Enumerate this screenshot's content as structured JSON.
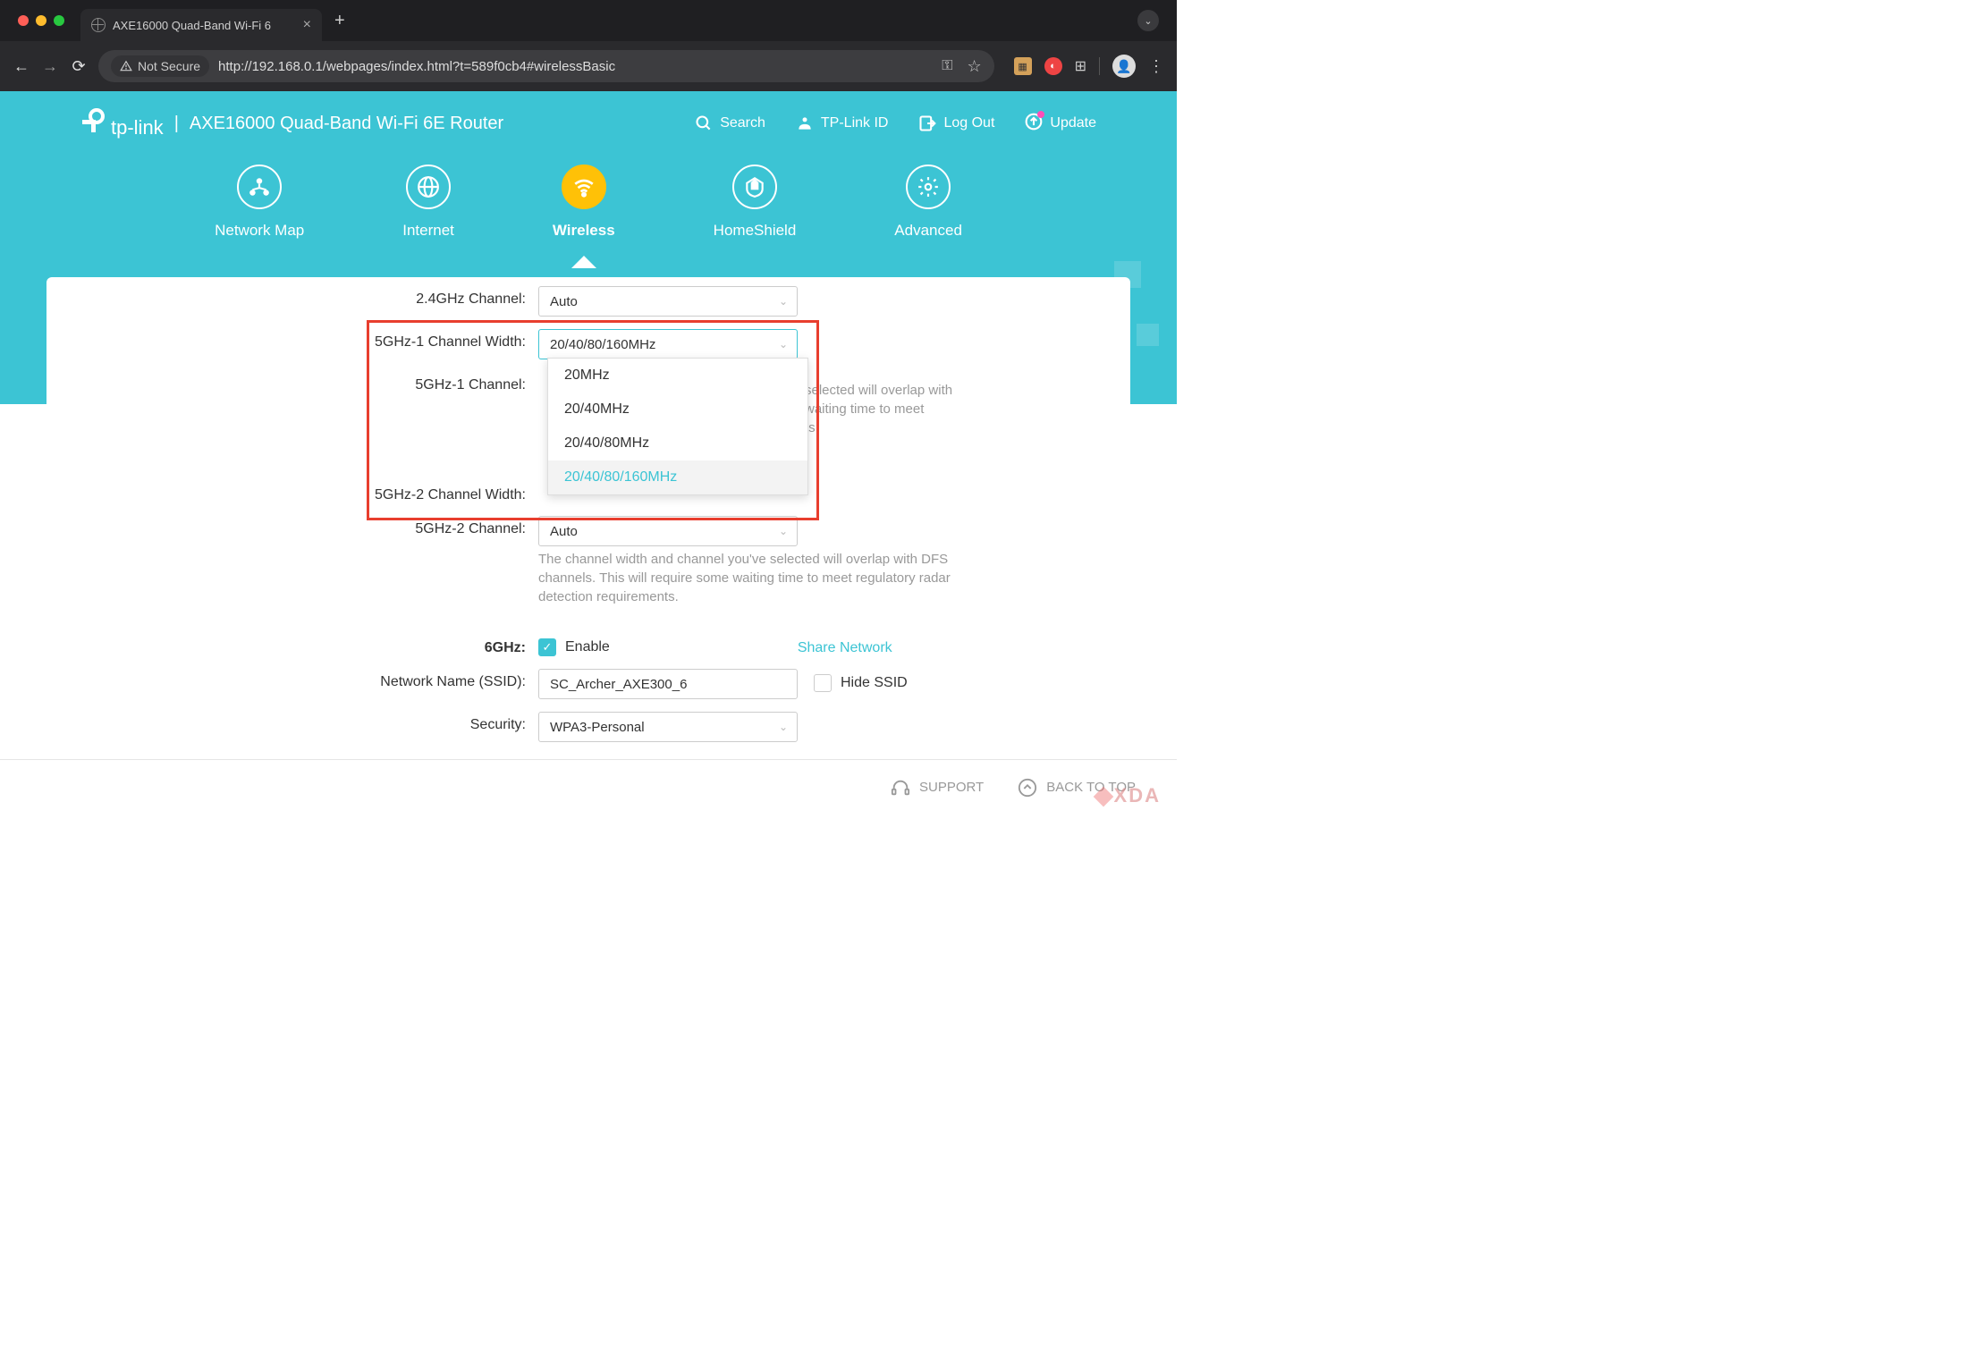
{
  "browser": {
    "tab_title": "AXE16000 Quad-Band Wi-Fi 6",
    "not_secure": "Not Secure",
    "url": "http://192.168.0.1/webpages/index.html?t=589f0cb4#wirelessBasic"
  },
  "header": {
    "brand": "tp-link",
    "product": "AXE16000 Quad-Band Wi-Fi 6E Router",
    "links": {
      "search": "Search",
      "tplink_id": "TP-Link ID",
      "logout": "Log Out",
      "update": "Update"
    }
  },
  "nav": {
    "network_map": "Network Map",
    "internet": "Internet",
    "wireless": "Wireless",
    "homeshield": "HomeShield",
    "advanced": "Advanced"
  },
  "form": {
    "channel_24_label": "2.4GHz Channel:",
    "channel_24_value": "Auto",
    "width_5g1_label": "5GHz-1 Channel Width:",
    "width_5g1_value": "20/40/80/160MHz",
    "channel_5g1_label": "5GHz-1 Channel:",
    "width_5g2_label": "5GHz-2 Channel Width:",
    "channel_5g2_label": "5GHz-2 Channel:",
    "channel_5g2_value": "Auto",
    "dfs_warning": "The channel width and channel you've selected will overlap with DFS channels. This will require some waiting time to meet regulatory radar detection requirements.",
    "dfs_warning_partial": "selected will overlap with waiting time to meet ts.",
    "band_6_label": "6GHz:",
    "enable": "Enable",
    "share_network": "Share Network",
    "ssid_label": "Network Name (SSID):",
    "ssid_value": "SC_Archer_AXE300_6",
    "hide_ssid": "Hide SSID",
    "security_label": "Security:",
    "security_value": "WPA3-Personal"
  },
  "dropdown": {
    "opt1": "20MHz",
    "opt2": "20/40MHz",
    "opt3": "20/40/80MHz",
    "opt4": "20/40/80/160MHz"
  },
  "footer": {
    "support": "SUPPORT",
    "back_to_top": "BACK TO TOP"
  },
  "watermark": "XDA"
}
